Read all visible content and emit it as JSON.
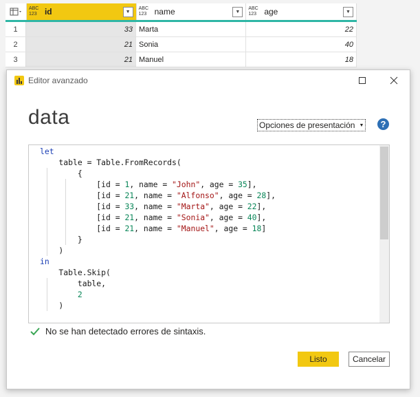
{
  "grid": {
    "columns": [
      {
        "type_top": "ABC",
        "type_bottom": "123",
        "name": "id"
      },
      {
        "type_top": "ABC",
        "type_bottom": "123",
        "name": "name"
      },
      {
        "type_top": "ABC",
        "type_bottom": "123",
        "name": "age"
      }
    ],
    "rows": [
      {
        "n": "1",
        "id": "33",
        "name": "Marta",
        "age": "22"
      },
      {
        "n": "2",
        "id": "21",
        "name": "Sonia",
        "age": "40"
      },
      {
        "n": "3",
        "id": "21",
        "name": "Manuel",
        "age": "18"
      }
    ]
  },
  "dialog": {
    "title": "Editor avanzado",
    "query_name": "data",
    "display_options": "Opciones de presentación",
    "help": "?",
    "syntax_status": "No se han detectado errores de sintaxis.",
    "ok_label": "Listo",
    "cancel_label": "Cancelar"
  },
  "code": {
    "lines": [
      "let",
      "    table = Table.FromRecords(",
      "        {",
      "            [id = 1, name = \"John\", age = 35],",
      "            [id = 21, name = \"Alfonso\", age = 28],",
      "            [id = 33, name = \"Marta\", age = 22],",
      "            [id = 21, name = \"Sonia\", age = 40],",
      "            [id = 21, name = \"Manuel\", age = 18]",
      "        }",
      "    )",
      "in",
      "    Table.Skip(",
      "        table,",
      "        2",
      "    )"
    ]
  },
  "colors": {
    "accent": "#f2c811",
    "teal": "#2fb6a5",
    "help_blue": "#2d6fb5",
    "check_green": "#3aa655"
  }
}
